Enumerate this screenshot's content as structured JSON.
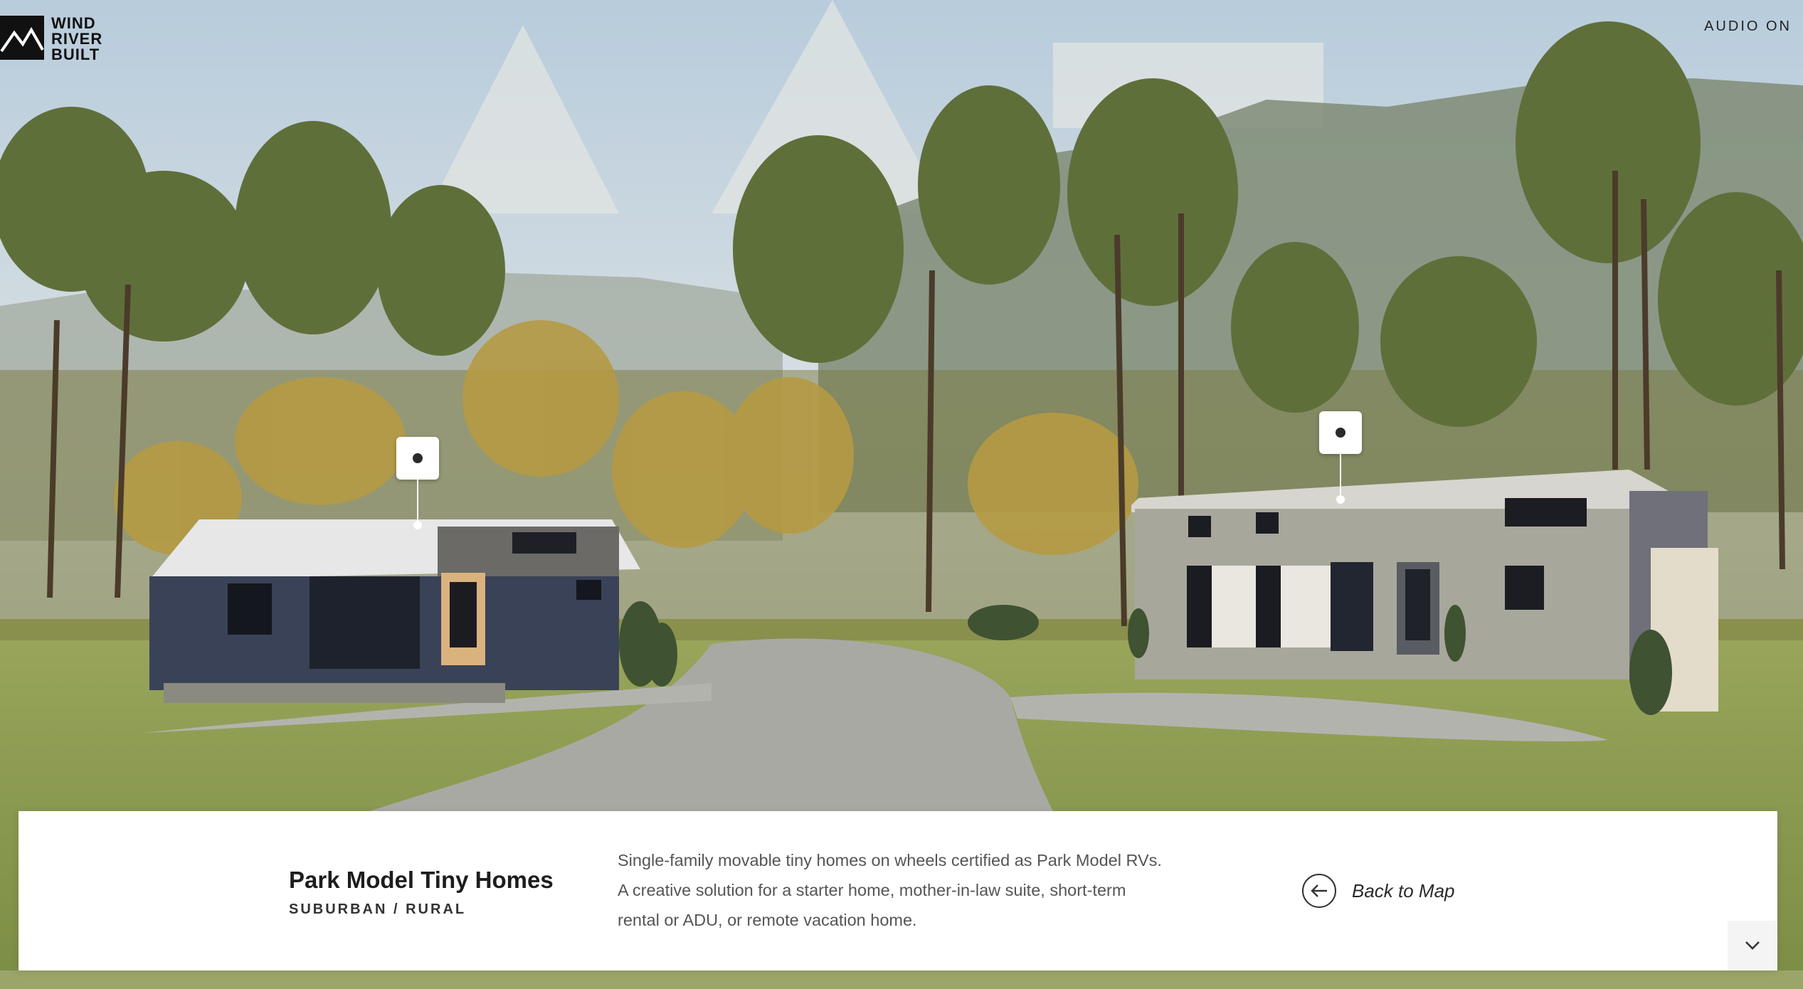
{
  "brand": {
    "logo_lines": [
      "WIND",
      "RIVER",
      "BUILT"
    ]
  },
  "header": {
    "audio_label": "AUDIO ON"
  },
  "hotspots": [
    {
      "name": "park-model-left-home",
      "icon": "dot-icon"
    },
    {
      "name": "park-model-right-home",
      "icon": "dot-icon"
    }
  ],
  "panel": {
    "title": "Park Model Tiny Homes",
    "subtitle": "SUBURBAN / RURAL",
    "description_lines": [
      "Single-family movable tiny homes on wheels certified as Park Model RVs.",
      "A creative solution for a starter home, mother-in-law suite, short-term",
      "rental or ADU, or remote vacation home."
    ],
    "back_label": "Back to Map",
    "back_icon": "arrow-left-icon",
    "collapse_icon": "chevron-down-icon"
  },
  "colors": {
    "sky": "#c7d7e2",
    "grass": "#8f9c57",
    "road": "#a9a9a4",
    "left_home": "#3a4257",
    "right_home": "#a8a79c"
  }
}
